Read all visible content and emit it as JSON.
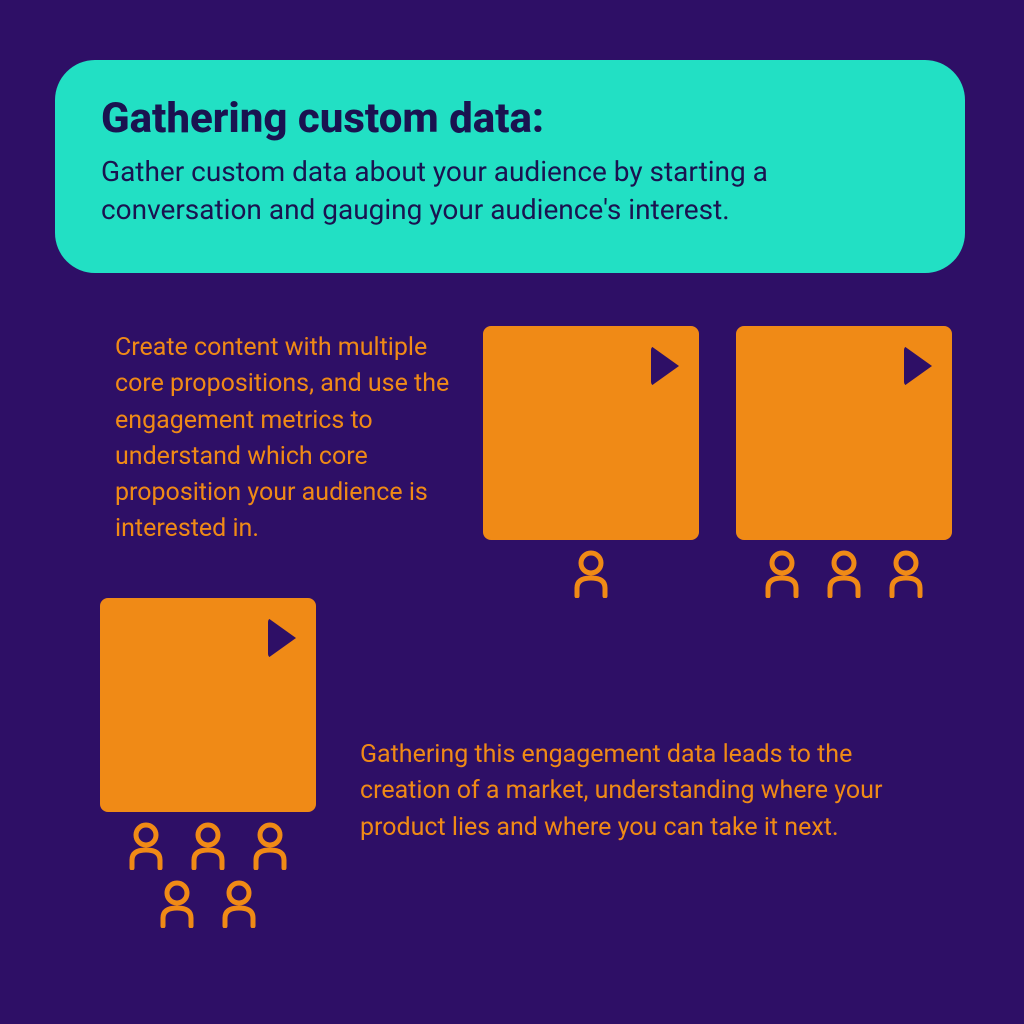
{
  "colors": {
    "bg": "#2e0f66",
    "card_bg": "#22e0c4",
    "card_text": "#1a1350",
    "accent": "#f08a16"
  },
  "card": {
    "title": "Gathering custom data:",
    "subtitle": "Gather custom data about your audience by starting a conversation and gauging your audience's interest."
  },
  "body": {
    "paragraph1": "Create content with multiple core propositions, and use the engagement metrics to understand which core proposition your audience is interested in.",
    "paragraph2": "Gathering this engagement data leads to the creation of a market, understanding where your product lies and where you can take it next."
  },
  "icons": {
    "play": "play-icon",
    "person": "person-icon"
  },
  "tiles": [
    {
      "id": "tile-a",
      "people": 1
    },
    {
      "id": "tile-b",
      "people": 3
    },
    {
      "id": "tile-c",
      "people": 5
    }
  ]
}
